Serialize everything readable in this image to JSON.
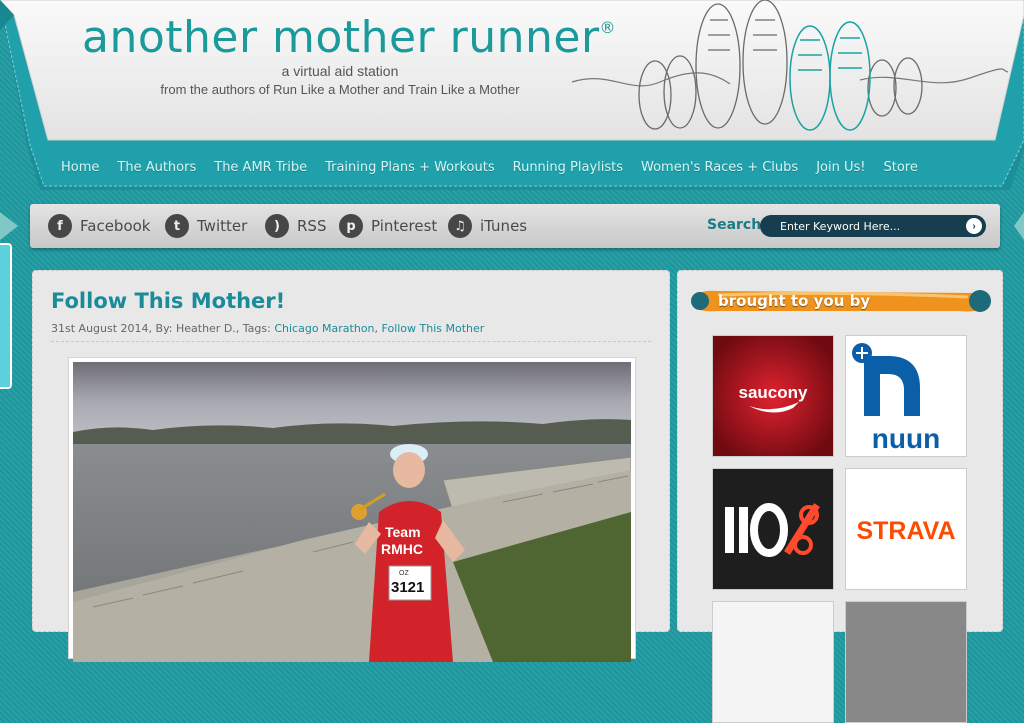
{
  "header": {
    "title": "another mother runner",
    "registered_mark": "®",
    "tagline": "a virtual aid station",
    "subtagline": "from the authors of Run Like a Mother and Train Like a Mother"
  },
  "nav": {
    "items": [
      "Home",
      "The Authors",
      "The AMR Tribe",
      "Training Plans + Workouts",
      "Running Playlists",
      "Women's Races + Clubs",
      "Join Us!",
      "Store"
    ]
  },
  "social": {
    "items": [
      {
        "label": "Facebook",
        "icon": "facebook-icon",
        "glyph": "f"
      },
      {
        "label": "Twitter",
        "icon": "twitter-icon",
        "glyph": "t"
      },
      {
        "label": "RSS",
        "icon": "rss-icon",
        "glyph": ")"
      },
      {
        "label": "Pinterest",
        "icon": "pinterest-icon",
        "glyph": "p"
      },
      {
        "label": "iTunes",
        "icon": "itunes-icon",
        "glyph": "♫"
      }
    ]
  },
  "search": {
    "label": "Search",
    "placeholder": "Enter Keyword Here...",
    "go_glyph": "›"
  },
  "post": {
    "title": "Follow This Mother!",
    "meta_prefix": "31st August 2014, By: Heather D., Tags: ",
    "tag1": "Chicago Marathon",
    "tag_sep": ", ",
    "tag2": "Follow This Mother",
    "photo": {
      "shirt_text_1": "Team",
      "shirt_text_2": "RMHC",
      "bib_number": "3121",
      "bib_top": "OZ"
    }
  },
  "sidebar": {
    "banner": "brought to you by",
    "sponsors": [
      {
        "name": "saucony",
        "bg": "#b3101a"
      },
      {
        "name": "nuun",
        "bg": "#ffffff"
      },
      {
        "name": "110%",
        "bg": "#1e1e1e"
      },
      {
        "name": "STRAVA",
        "bg": "#ffffff"
      }
    ]
  },
  "colors": {
    "teal_bg": "#1f9aa0",
    "title_teal": "#1a9a9a",
    "strava_orange": "#fc4c02",
    "nuun_blue": "#0b5ea8"
  }
}
